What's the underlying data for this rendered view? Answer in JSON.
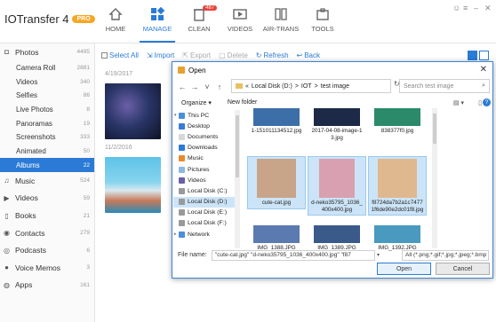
{
  "app": {
    "title": "IOTransfer 4",
    "badge": "PRO"
  },
  "nav": [
    {
      "label": "HOME",
      "icon": "home-icon"
    },
    {
      "label": "MANAGE",
      "icon": "manage-icon",
      "active": true
    },
    {
      "label": "CLEAN",
      "icon": "clean-icon",
      "badge": "487"
    },
    {
      "label": "VIDEOS",
      "icon": "video-icon"
    },
    {
      "label": "AIR-TRANS",
      "icon": "air-trans-icon"
    },
    {
      "label": "TOOLS",
      "icon": "tools-icon"
    }
  ],
  "sidebar": [
    {
      "label": "Photos",
      "count": "4495",
      "icon": "camera-icon",
      "top": true
    },
    {
      "label": "Camera Roll",
      "count": "2881"
    },
    {
      "label": "Videos",
      "count": "340"
    },
    {
      "label": "Selfies",
      "count": "86"
    },
    {
      "label": "Live Photos",
      "count": "8"
    },
    {
      "label": "Panoramas",
      "count": "19"
    },
    {
      "label": "Screenshots",
      "count": "333"
    },
    {
      "label": "Animated",
      "count": "50"
    },
    {
      "label": "Albums",
      "count": "22",
      "active": true
    },
    {
      "label": "Music",
      "count": "524",
      "icon": "music-icon",
      "top": true
    },
    {
      "label": "Videos",
      "count": "59",
      "icon": "video-icon",
      "top": true
    },
    {
      "label": "Books",
      "count": "21",
      "icon": "book-icon",
      "top": true
    },
    {
      "label": "Contacts",
      "count": "279",
      "icon": "contacts-icon",
      "top": true
    },
    {
      "label": "Podcasts",
      "count": "6",
      "icon": "podcast-icon",
      "top": true
    },
    {
      "label": "Voice Memos",
      "count": "3",
      "icon": "mic-icon",
      "top": true
    },
    {
      "label": "Apps",
      "count": "161",
      "icon": "apps-icon",
      "top": true
    }
  ],
  "toolbar": {
    "select_all": "Select All",
    "import": "Import",
    "export": "Export",
    "delete": "Delete",
    "refresh": "Refresh",
    "back": "Back"
  },
  "content": {
    "date1": "4/19/2017",
    "date2": "11/2/2016"
  },
  "dialog": {
    "title": "Open",
    "path_root": "Local Disk (D:)",
    "path_sep": ">",
    "path_1": "IOT",
    "path_2": "test image",
    "search_placeholder": "Search test image",
    "organize": "Organize ▾",
    "new_folder": "New folder",
    "nav_items": [
      {
        "label": "This PC",
        "icon": "pc-icon",
        "color": "#4a90d9"
      },
      {
        "label": "Desktop",
        "icon": "desktop-icon",
        "color": "#3a7bd5"
      },
      {
        "label": "Documents",
        "icon": "documents-icon",
        "color": "#d8d8d8"
      },
      {
        "label": "Downloads",
        "icon": "downloads-icon",
        "color": "#2b7bd6"
      },
      {
        "label": "Music",
        "icon": "music-icon",
        "color": "#e88a2e"
      },
      {
        "label": "Pictures",
        "icon": "pictures-icon",
        "color": "#8fb8e0"
      },
      {
        "label": "Videos",
        "icon": "videos-icon",
        "color": "#6b5ea8"
      },
      {
        "label": "Local Disk (C:)",
        "icon": "disk-icon",
        "color": "#999999"
      },
      {
        "label": "Local Disk (D:)",
        "icon": "disk-icon",
        "color": "#999999",
        "selected": true
      },
      {
        "label": "Local Disk (E:)",
        "icon": "disk-icon",
        "color": "#999999"
      },
      {
        "label": "Local Disk (F:)",
        "icon": "disk-icon",
        "color": "#999999"
      },
      {
        "label": "Network",
        "icon": "network-icon",
        "color": "#4a90d9"
      }
    ],
    "files": [
      {
        "name": "1-151011134512.jpg",
        "color": "#3c6fa8"
      },
      {
        "name": "2017-04-08-image-13.jpg",
        "color": "#1c2a48"
      },
      {
        "name": "838377f0.jpg",
        "color": "#2a8a6a"
      },
      {
        "name": "cute-cat.jpg",
        "color": "#c8a488",
        "selected": true
      },
      {
        "name": "d-neko35795_1036_400x400.jpg",
        "color": "#d8a0b0",
        "selected": true
      },
      {
        "name": "f8724da7b2a1c74771f6de90e2dc01f8.jpg",
        "color": "#e0b890",
        "selected": true
      },
      {
        "name": "IMG_1388.JPG",
        "color": "#5a7ab0"
      },
      {
        "name": "IMG_1389.JPG",
        "color": "#3a5a8a"
      },
      {
        "name": "IMG_1392.JPG",
        "color": "#4a9ac0"
      }
    ],
    "filename_label": "File name:",
    "filename_value": "\"cute-cat.jpg\" \"d-neko35795_1036_400x400.jpg\" \"f87",
    "filetype_value": "All (*.png;*.gif;*.jpg;*.jpeg;*.bmp",
    "open_label": "Open",
    "cancel_label": "Cancel"
  }
}
